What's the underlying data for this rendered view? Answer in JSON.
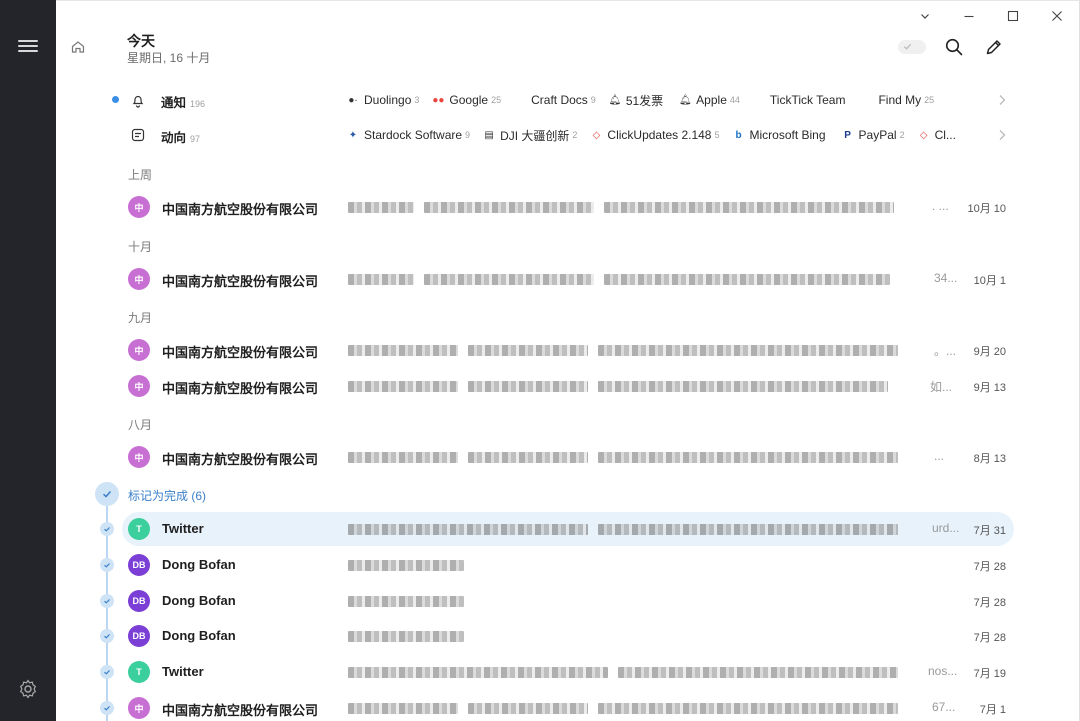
{
  "header": {
    "title": "今天",
    "subtitle": "星期日, 16 十月"
  },
  "categories": [
    {
      "name": "通知",
      "count": "196",
      "senders": [
        {
          "name": "Duolingo",
          "count": "3",
          "icon": "duolingo-icon"
        },
        {
          "name": "Google",
          "count": "25",
          "icon": "google-icon"
        },
        {
          "name": "Craft Docs",
          "count": "9",
          "icon": "craft-icon"
        },
        {
          "name": "51发票",
          "count": "",
          "icon": "bell-icon"
        },
        {
          "name": "Apple",
          "count": "44",
          "icon": "bell-icon"
        },
        {
          "name": "TickTick Team",
          "count": "",
          "icon": "apple-icon"
        },
        {
          "name": "Find My",
          "count": "25",
          "icon": "apple-icon"
        }
      ]
    },
    {
      "name": "动向",
      "count": "97",
      "senders": [
        {
          "name": "Stardock Software",
          "count": "9",
          "icon": "stardock-icon"
        },
        {
          "name": "DJI 大疆创新",
          "count": "2",
          "icon": "doc-icon"
        },
        {
          "name": "ClickUpdates 2.148",
          "count": "5",
          "icon": "clickup-icon"
        },
        {
          "name": "Microsoft Bing",
          "count": "",
          "icon": "bing-icon"
        },
        {
          "name": "PayPal",
          "count": "2",
          "icon": "paypal-icon"
        },
        {
          "name": "Cl...",
          "count": "",
          "icon": "clickup-icon"
        }
      ]
    }
  ],
  "sections": {
    "last_week": "上周",
    "october": "十月",
    "september": "九月",
    "august": "八月",
    "done": "标记为完成 (6)"
  },
  "emails": [
    {
      "avatar": "中",
      "sender": "中国南方航空股份有限公司",
      "tail": ". ...",
      "date": "10月 10"
    },
    {
      "avatar": "中",
      "sender": "中国南方航空股份有限公司",
      "tail": "34...",
      "date": "10月 1"
    },
    {
      "avatar": "中",
      "sender": "中国南方航空股份有限公司",
      "tail": "。...",
      "date": "9月 20"
    },
    {
      "avatar": "中",
      "sender": "中国南方航空股份有限公司",
      "tail": "如...",
      "date": "9月 13"
    },
    {
      "avatar": "中",
      "sender": "中国南方航空股份有限公司",
      "tail": "...",
      "date": "8月 13"
    }
  ],
  "done_emails": [
    {
      "avatar": "T",
      "sender": "Twitter",
      "tail": "urd...",
      "date": "7月 31"
    },
    {
      "avatar": "DB",
      "sender": "Dong Bofan",
      "tail": "",
      "date": "7月 28"
    },
    {
      "avatar": "DB",
      "sender": "Dong Bofan",
      "tail": "",
      "date": "7月 28"
    },
    {
      "avatar": "DB",
      "sender": "Dong Bofan",
      "tail": "",
      "date": "7月 28"
    },
    {
      "avatar": "T",
      "sender": "Twitter",
      "tail": "nos...",
      "date": "7月 19"
    },
    {
      "avatar": "中",
      "sender": "中国南方航空股份有限公司",
      "tail": "67...",
      "date": "7月 1"
    }
  ],
  "colors": {
    "sidebar": "#23252a",
    "avatar_airline": "#c86fd4",
    "avatar_twitter": "#3ccf9e",
    "avatar_dong": "#7b3fd6",
    "accent": "#3a8ee6",
    "selected_row": "#e8f2fb"
  }
}
